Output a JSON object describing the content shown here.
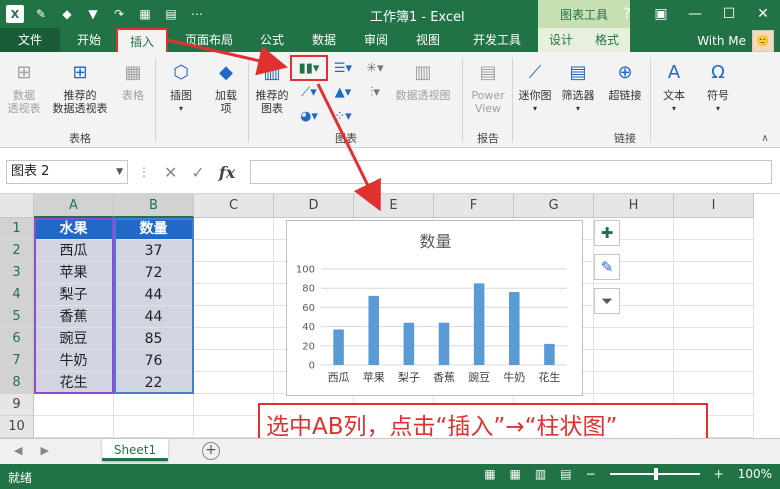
{
  "window": {
    "title": "工作簿1 - Excel",
    "context_tab_header": "图表工具",
    "user": "With Me",
    "avatar_text": "🙂"
  },
  "tabs": [
    {
      "label": "文件"
    },
    {
      "label": "开始"
    },
    {
      "label": "插入"
    },
    {
      "label": "页面布局"
    },
    {
      "label": "公式"
    },
    {
      "label": "数据"
    },
    {
      "label": "审阅"
    },
    {
      "label": "视图"
    },
    {
      "label": "开发工具"
    },
    {
      "label": "设计"
    },
    {
      "label": "格式"
    }
  ],
  "ribbon": {
    "pivot_table": "数据\n透视表",
    "recommended_pivot": "推荐的\n数据透视表",
    "table": "表格",
    "group_tables": "表格",
    "illustrations": "插图",
    "addins": "加载\n项",
    "recommended_charts": "推荐的\n图表",
    "pivot_chart": "数据透视图",
    "group_charts": "图表",
    "power_view": "Power\nView",
    "group_reports": "报告",
    "sparkline": "迷你图",
    "filter": "筛选器",
    "hyperlink": "超链接",
    "group_links": "链接",
    "text": "文本",
    "symbol": "符号"
  },
  "formula_bar": {
    "name_box": "图表 2",
    "fx": "fx"
  },
  "grid": {
    "columns": [
      "A",
      "B",
      "C",
      "D",
      "E",
      "F",
      "G",
      "H",
      "I"
    ],
    "rows": [
      "1",
      "2",
      "3",
      "4",
      "5",
      "6",
      "7",
      "8",
      "9",
      "10"
    ],
    "header": [
      "水果",
      "数量"
    ],
    "items": [
      {
        "name": "西瓜",
        "qty": "37"
      },
      {
        "name": "苹果",
        "qty": "72"
      },
      {
        "name": "梨子",
        "qty": "44"
      },
      {
        "name": "香蕉",
        "qty": "44"
      },
      {
        "name": "豌豆",
        "qty": "85"
      },
      {
        "name": "牛奶",
        "qty": "76"
      },
      {
        "name": "花生",
        "qty": "22"
      }
    ]
  },
  "chart_data": {
    "type": "bar",
    "title": "数量",
    "categories": [
      "西瓜",
      "苹果",
      "梨子",
      "香蕉",
      "豌豆",
      "牛奶",
      "花生"
    ],
    "values": [
      37,
      72,
      44,
      44,
      85,
      76,
      22
    ],
    "yticks": [
      "0",
      "20",
      "40",
      "60",
      "80",
      "100"
    ],
    "ylim": [
      0,
      100
    ],
    "grid": true,
    "legend": "none",
    "bar_color": "#5b9bd5"
  },
  "annotation": "选中AB列，点击“插入”→“柱状图”",
  "sheet": {
    "tab": "Sheet1"
  },
  "status": {
    "ready": "就绪",
    "zoom": "100%"
  },
  "colors": {
    "excel_green": "#217346",
    "annotation_red": "#e03030"
  }
}
